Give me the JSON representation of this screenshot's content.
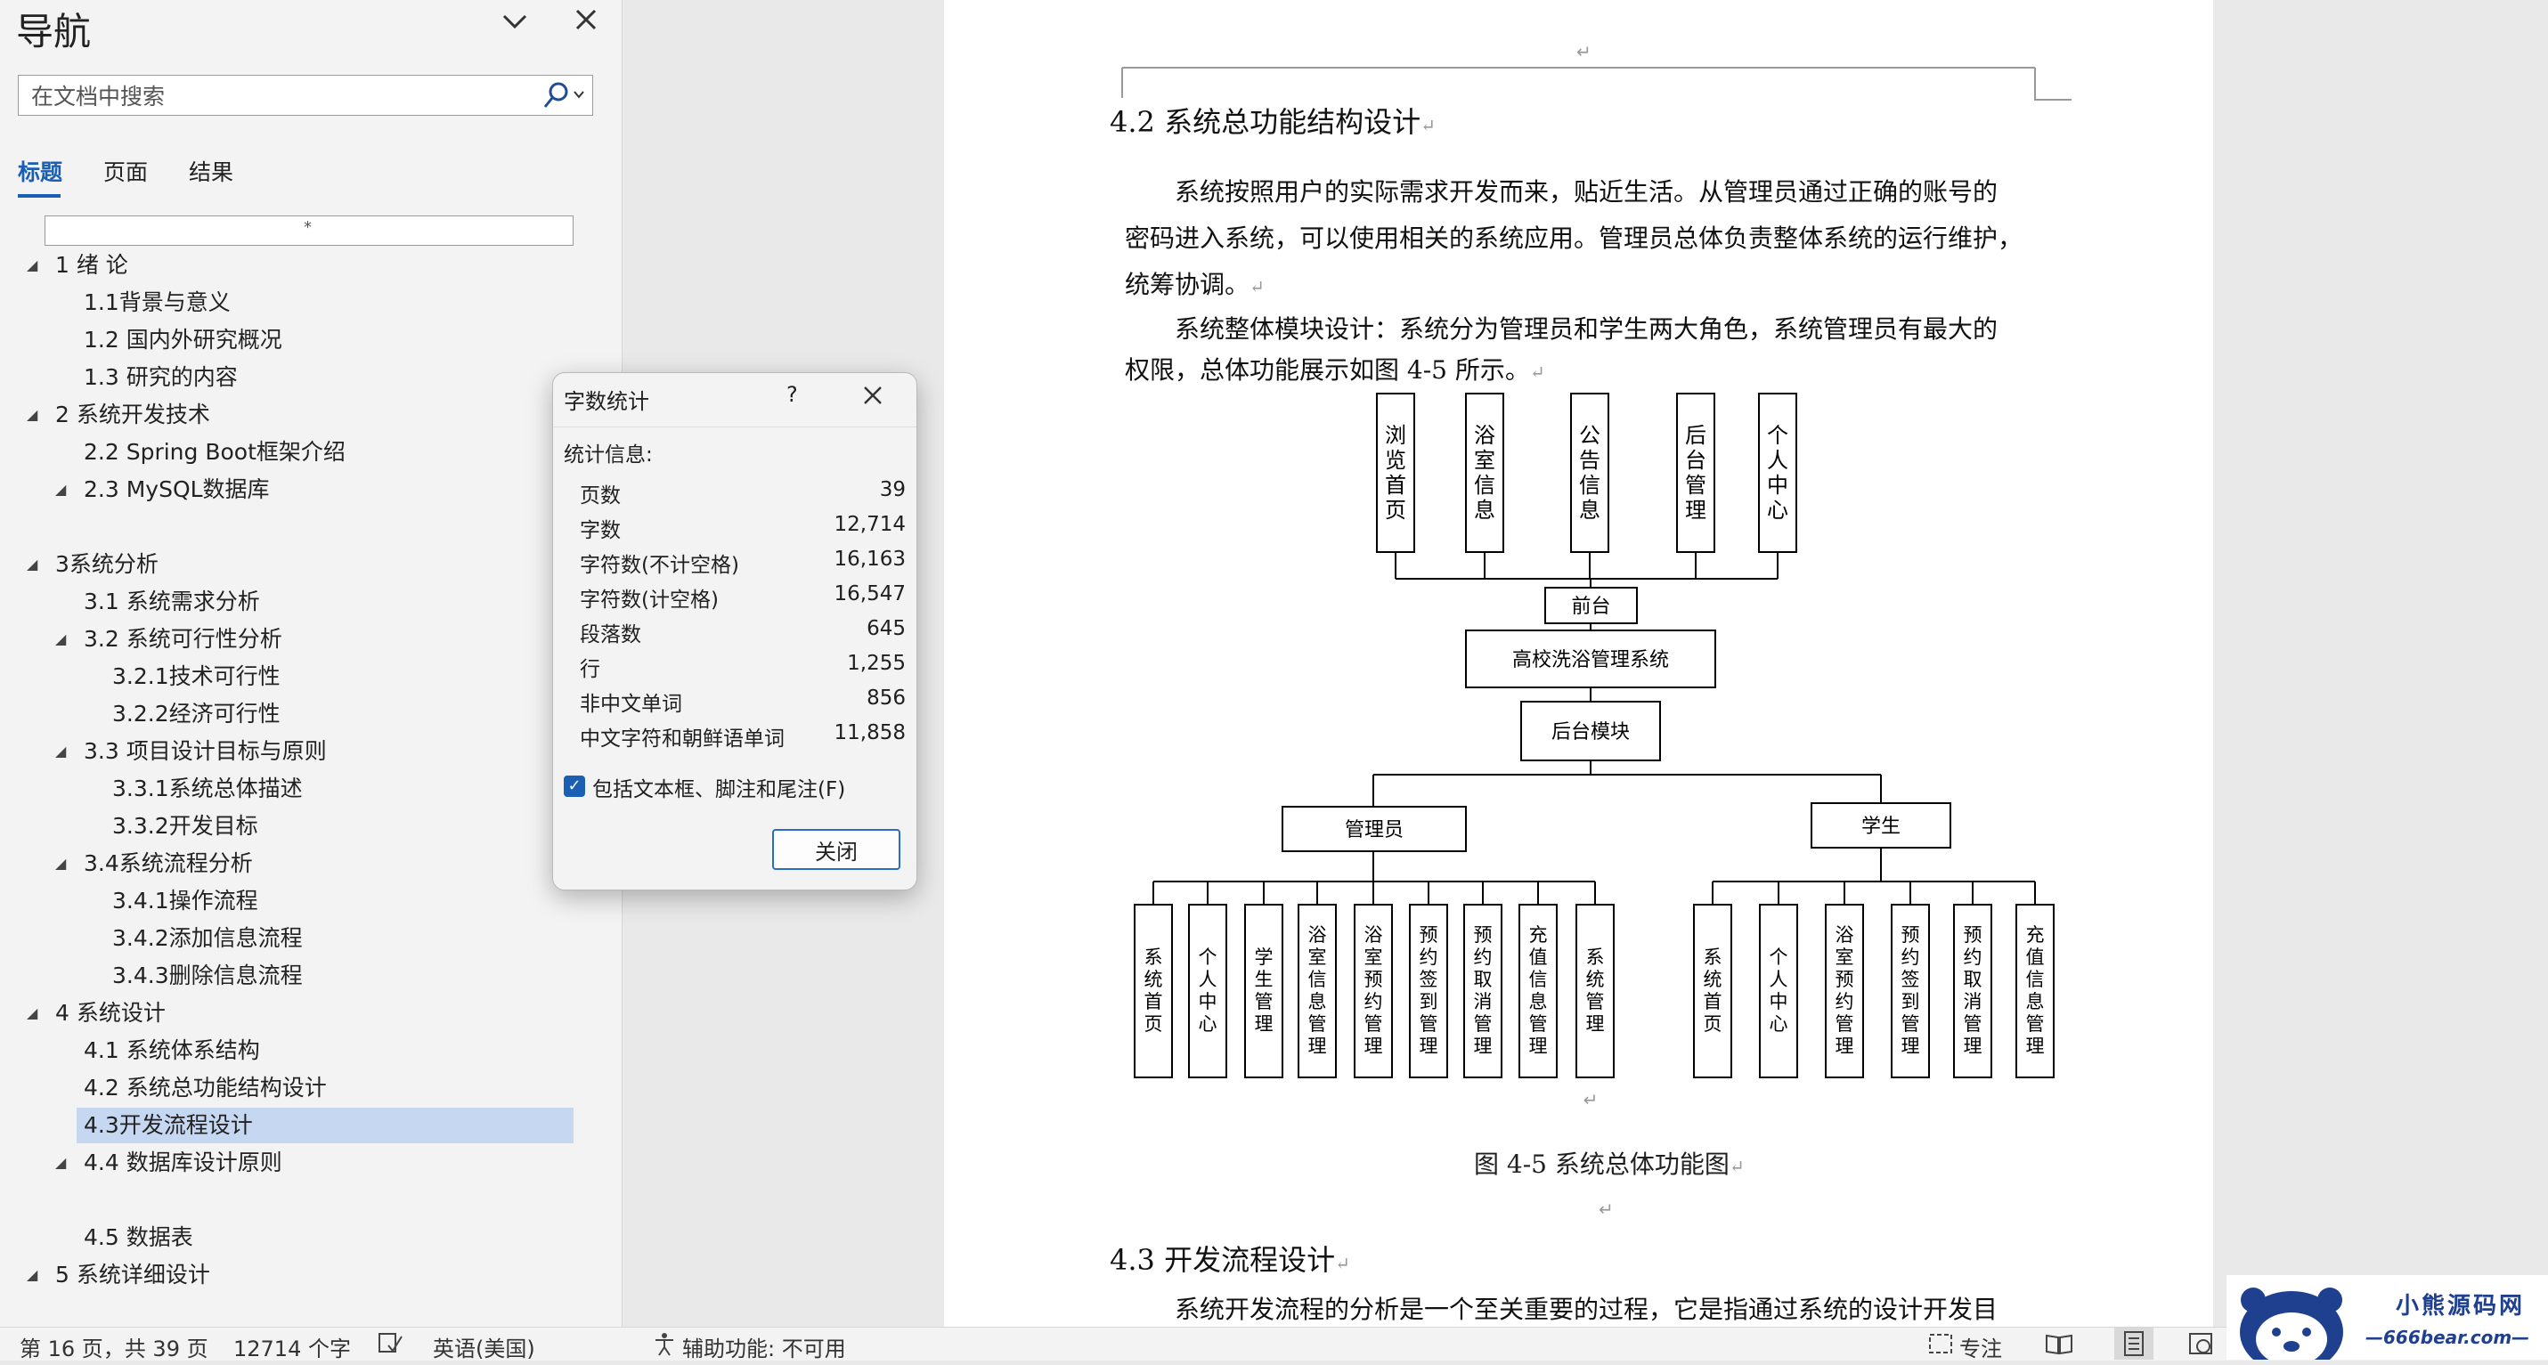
{
  "nav": {
    "title": "导航",
    "search_placeholder": "在文档中搜索",
    "tabs": [
      "标题",
      "页面",
      "结果"
    ],
    "collapse_marker": "*",
    "tree": [
      {
        "label": "1 绪  论",
        "level": 1,
        "expandable": true
      },
      {
        "label": "1.1背景与意义",
        "level": 2,
        "expandable": false
      },
      {
        "label": "1.2 国内外研究概况",
        "level": 2,
        "expandable": false
      },
      {
        "label": "1.3 研究的内容",
        "level": 2,
        "expandable": false
      },
      {
        "label": "2 系统开发技术",
        "level": 1,
        "expandable": true
      },
      {
        "label": "2.2 Spring Boot框架介绍",
        "level": 2,
        "expandable": false
      },
      {
        "label": "2.3 MySQL数据库",
        "level": 2,
        "expandable": true
      },
      {
        "label": "",
        "level": 2,
        "expandable": false
      },
      {
        "label": "3系统分析",
        "level": 1,
        "expandable": true
      },
      {
        "label": "3.1 系统需求分析",
        "level": 2,
        "expandable": false
      },
      {
        "label": "3.2 系统可行性分析",
        "level": 2,
        "expandable": true
      },
      {
        "label": "3.2.1技术可行性",
        "level": 3,
        "expandable": false
      },
      {
        "label": "3.2.2经济可行性",
        "level": 3,
        "expandable": false
      },
      {
        "label": "3.3 项目设计目标与原则",
        "level": 2,
        "expandable": true
      },
      {
        "label": "3.3.1系统总体描述",
        "level": 3,
        "expandable": false
      },
      {
        "label": "3.3.2开发目标",
        "level": 3,
        "expandable": false
      },
      {
        "label": "3.4系统流程分析",
        "level": 2,
        "expandable": true
      },
      {
        "label": "3.4.1操作流程",
        "level": 3,
        "expandable": false
      },
      {
        "label": "3.4.2添加信息流程",
        "level": 3,
        "expandable": false
      },
      {
        "label": "3.4.3删除信息流程",
        "level": 3,
        "expandable": false
      },
      {
        "label": "4 系统设计",
        "level": 1,
        "expandable": true
      },
      {
        "label": "4.1 系统体系结构",
        "level": 2,
        "expandable": false
      },
      {
        "label": "4.2 系统总功能结构设计",
        "level": 2,
        "expandable": false
      },
      {
        "label": "4.3开发流程设计",
        "level": 2,
        "expandable": false,
        "selected": true
      },
      {
        "label": "4.4 数据库设计原则",
        "level": 2,
        "expandable": true
      },
      {
        "label": "",
        "level": 2,
        "expandable": false
      },
      {
        "label": "4.5 数据表",
        "level": 2,
        "expandable": false
      },
      {
        "label": "5 系统详细设计",
        "level": 1,
        "expandable": true
      }
    ]
  },
  "dialog": {
    "title": "字数统计",
    "help": "?",
    "section": "统计信息:",
    "stats": [
      {
        "label": "页数",
        "value": "39"
      },
      {
        "label": "字数",
        "value": "12,714"
      },
      {
        "label": "字符数(不计空格)",
        "value": "16,163"
      },
      {
        "label": "字符数(计空格)",
        "value": "16,547"
      },
      {
        "label": "段落数",
        "value": "645"
      },
      {
        "label": "行",
        "value": "1,255"
      },
      {
        "label": "非中文单词",
        "value": "856"
      },
      {
        "label": "中文字符和朝鲜语单词",
        "value": "11,858"
      }
    ],
    "checkbox_label": "包括文本框、脚注和尾注(F)",
    "checkbox_checked": true,
    "close_label": "关闭"
  },
  "doc": {
    "heading1": "4.2  系统总功能结构设计",
    "para1_line1": "系统按照用户的实际需求开发而来，贴近生活。从管理员通过正确的账号的",
    "para1_line2": "密码进入系统，可以使用相关的系统应用。管理员总体负责整体系统的运行维护，",
    "para1_line3": "统筹协调。",
    "para2_line1": "系统整体模块设计：系统分为管理员和学生两大角色，系统管理员有最大的",
    "para2_line2": "权限，总体功能展示如图 4-5 所示。",
    "caption": "图 4-5  系统总体功能图",
    "heading2": "4.3 开发流程设计",
    "para3_line1": "系统开发流程的分析是一个至关重要的过程，它是指通过系统的设计开发目",
    "return_mark": "↵"
  },
  "diagram": {
    "top_nodes": [
      "浏览首页",
      "浴室信息",
      "公告信息",
      "后台管理",
      "个人中心"
    ],
    "front": "前台",
    "system": "高校洗浴管理系统",
    "backend": "后台模块",
    "admin": "管理员",
    "student": "学生",
    "admin_children": [
      "系统首页",
      "个人中心",
      "学生管理",
      "浴室信息管理",
      "浴室预约管理",
      "预约签到管理",
      "预约取消管理",
      "充值信息管理",
      "系统管理"
    ],
    "student_children": [
      "系统首页",
      "个人中心",
      "浴室预约管理",
      "预约签到管理",
      "预约取消管理",
      "充值信息管理"
    ]
  },
  "status": {
    "page": "第 16 页，共 39 页",
    "words": "12714 个字",
    "language": "英语(美国)",
    "accessibility": "辅助功能: 不可用",
    "focus": "专注"
  },
  "watermark": {
    "name": "小熊源码网",
    "url": "—666bear.com—"
  }
}
